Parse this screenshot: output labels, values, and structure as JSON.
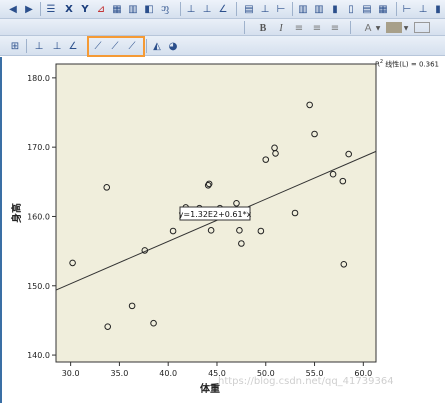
{
  "toolbar_row1": {
    "icons": [
      "undo-icon",
      "redo-icon",
      "data-editor-icon",
      "delete-icon",
      "variables-icon",
      "chart-builder-icon",
      "chart-options-icon",
      "table-icon",
      "new-icon",
      "lasso-icon",
      "bar-chart-icon",
      "line-chart-icon",
      "area-chart-icon",
      "grid-icon",
      "stacked-bar-icon",
      "clustered-bar-icon",
      "boxplot-icon",
      "align-bar-icon"
    ]
  },
  "toolbar_row2": {
    "font_combo_value": "",
    "size_combo_value": "",
    "bold_label": "B",
    "italic_label": "I",
    "font_color_label": "A"
  },
  "toolbar_row3": {
    "icons": [
      "pivot-table-icon",
      "bar-icon",
      "histogram-icon",
      "line-icon",
      "fit-line-total-icon",
      "fit-line-subgroup-icon",
      "fit-line-reference-icon",
      "area-icon",
      "pie-icon"
    ]
  },
  "chart_data": {
    "type": "scatter",
    "xlabel": "体重",
    "ylabel": "身高",
    "xlim": [
      28.5,
      61.3
    ],
    "ylim": [
      139,
      182
    ],
    "xticks": [
      "30.0",
      "35.0",
      "40.0",
      "45.0",
      "50.0",
      "55.0",
      "60.0"
    ],
    "xtick_values": [
      30,
      35,
      40,
      45,
      50,
      55,
      60
    ],
    "yticks": [
      "140.0",
      "150.0",
      "160.0",
      "170.0",
      "180.0"
    ],
    "ytick_values": [
      140,
      150,
      160,
      170,
      180
    ],
    "grid": false,
    "points": [
      {
        "x": 30.2,
        "y": 153.3
      },
      {
        "x": 33.7,
        "y": 164.2
      },
      {
        "x": 33.8,
        "y": 144.1
      },
      {
        "x": 36.3,
        "y": 147.1
      },
      {
        "x": 37.6,
        "y": 155.1
      },
      {
        "x": 38.5,
        "y": 144.6
      },
      {
        "x": 40.5,
        "y": 157.9
      },
      {
        "x": 41.8,
        "y": 161.3
      },
      {
        "x": 43.2,
        "y": 161.2
      },
      {
        "x": 44.1,
        "y": 164.5
      },
      {
        "x": 44.2,
        "y": 164.7
      },
      {
        "x": 44.4,
        "y": 158.0
      },
      {
        "x": 45.3,
        "y": 161.2
      },
      {
        "x": 47.0,
        "y": 161.9
      },
      {
        "x": 47.1,
        "y": 160.8
      },
      {
        "x": 47.3,
        "y": 158.0
      },
      {
        "x": 47.5,
        "y": 156.1
      },
      {
        "x": 49.5,
        "y": 157.9
      },
      {
        "x": 50.0,
        "y": 168.2
      },
      {
        "x": 50.9,
        "y": 169.9
      },
      {
        "x": 51.0,
        "y": 169.1
      },
      {
        "x": 53.0,
        "y": 160.5
      },
      {
        "x": 54.5,
        "y": 176.1
      },
      {
        "x": 55.0,
        "y": 171.9
      },
      {
        "x": 56.9,
        "y": 166.1
      },
      {
        "x": 57.9,
        "y": 165.1
      },
      {
        "x": 58.0,
        "y": 153.1
      },
      {
        "x": 58.5,
        "y": 169.0
      }
    ],
    "fit_line": {
      "intercept": 132.0,
      "slope": 0.61
    },
    "fit_label": "y=1.32E2+0.61*x",
    "legend": {
      "r2": "R",
      "r2_sup": "2",
      "text": "线性(L) = 0.361"
    }
  },
  "watermark": "https://blog.csdn.net/qq_41739364",
  "colors": {
    "plot_bg": "#f0eedc",
    "highlight": "#f59a35"
  }
}
